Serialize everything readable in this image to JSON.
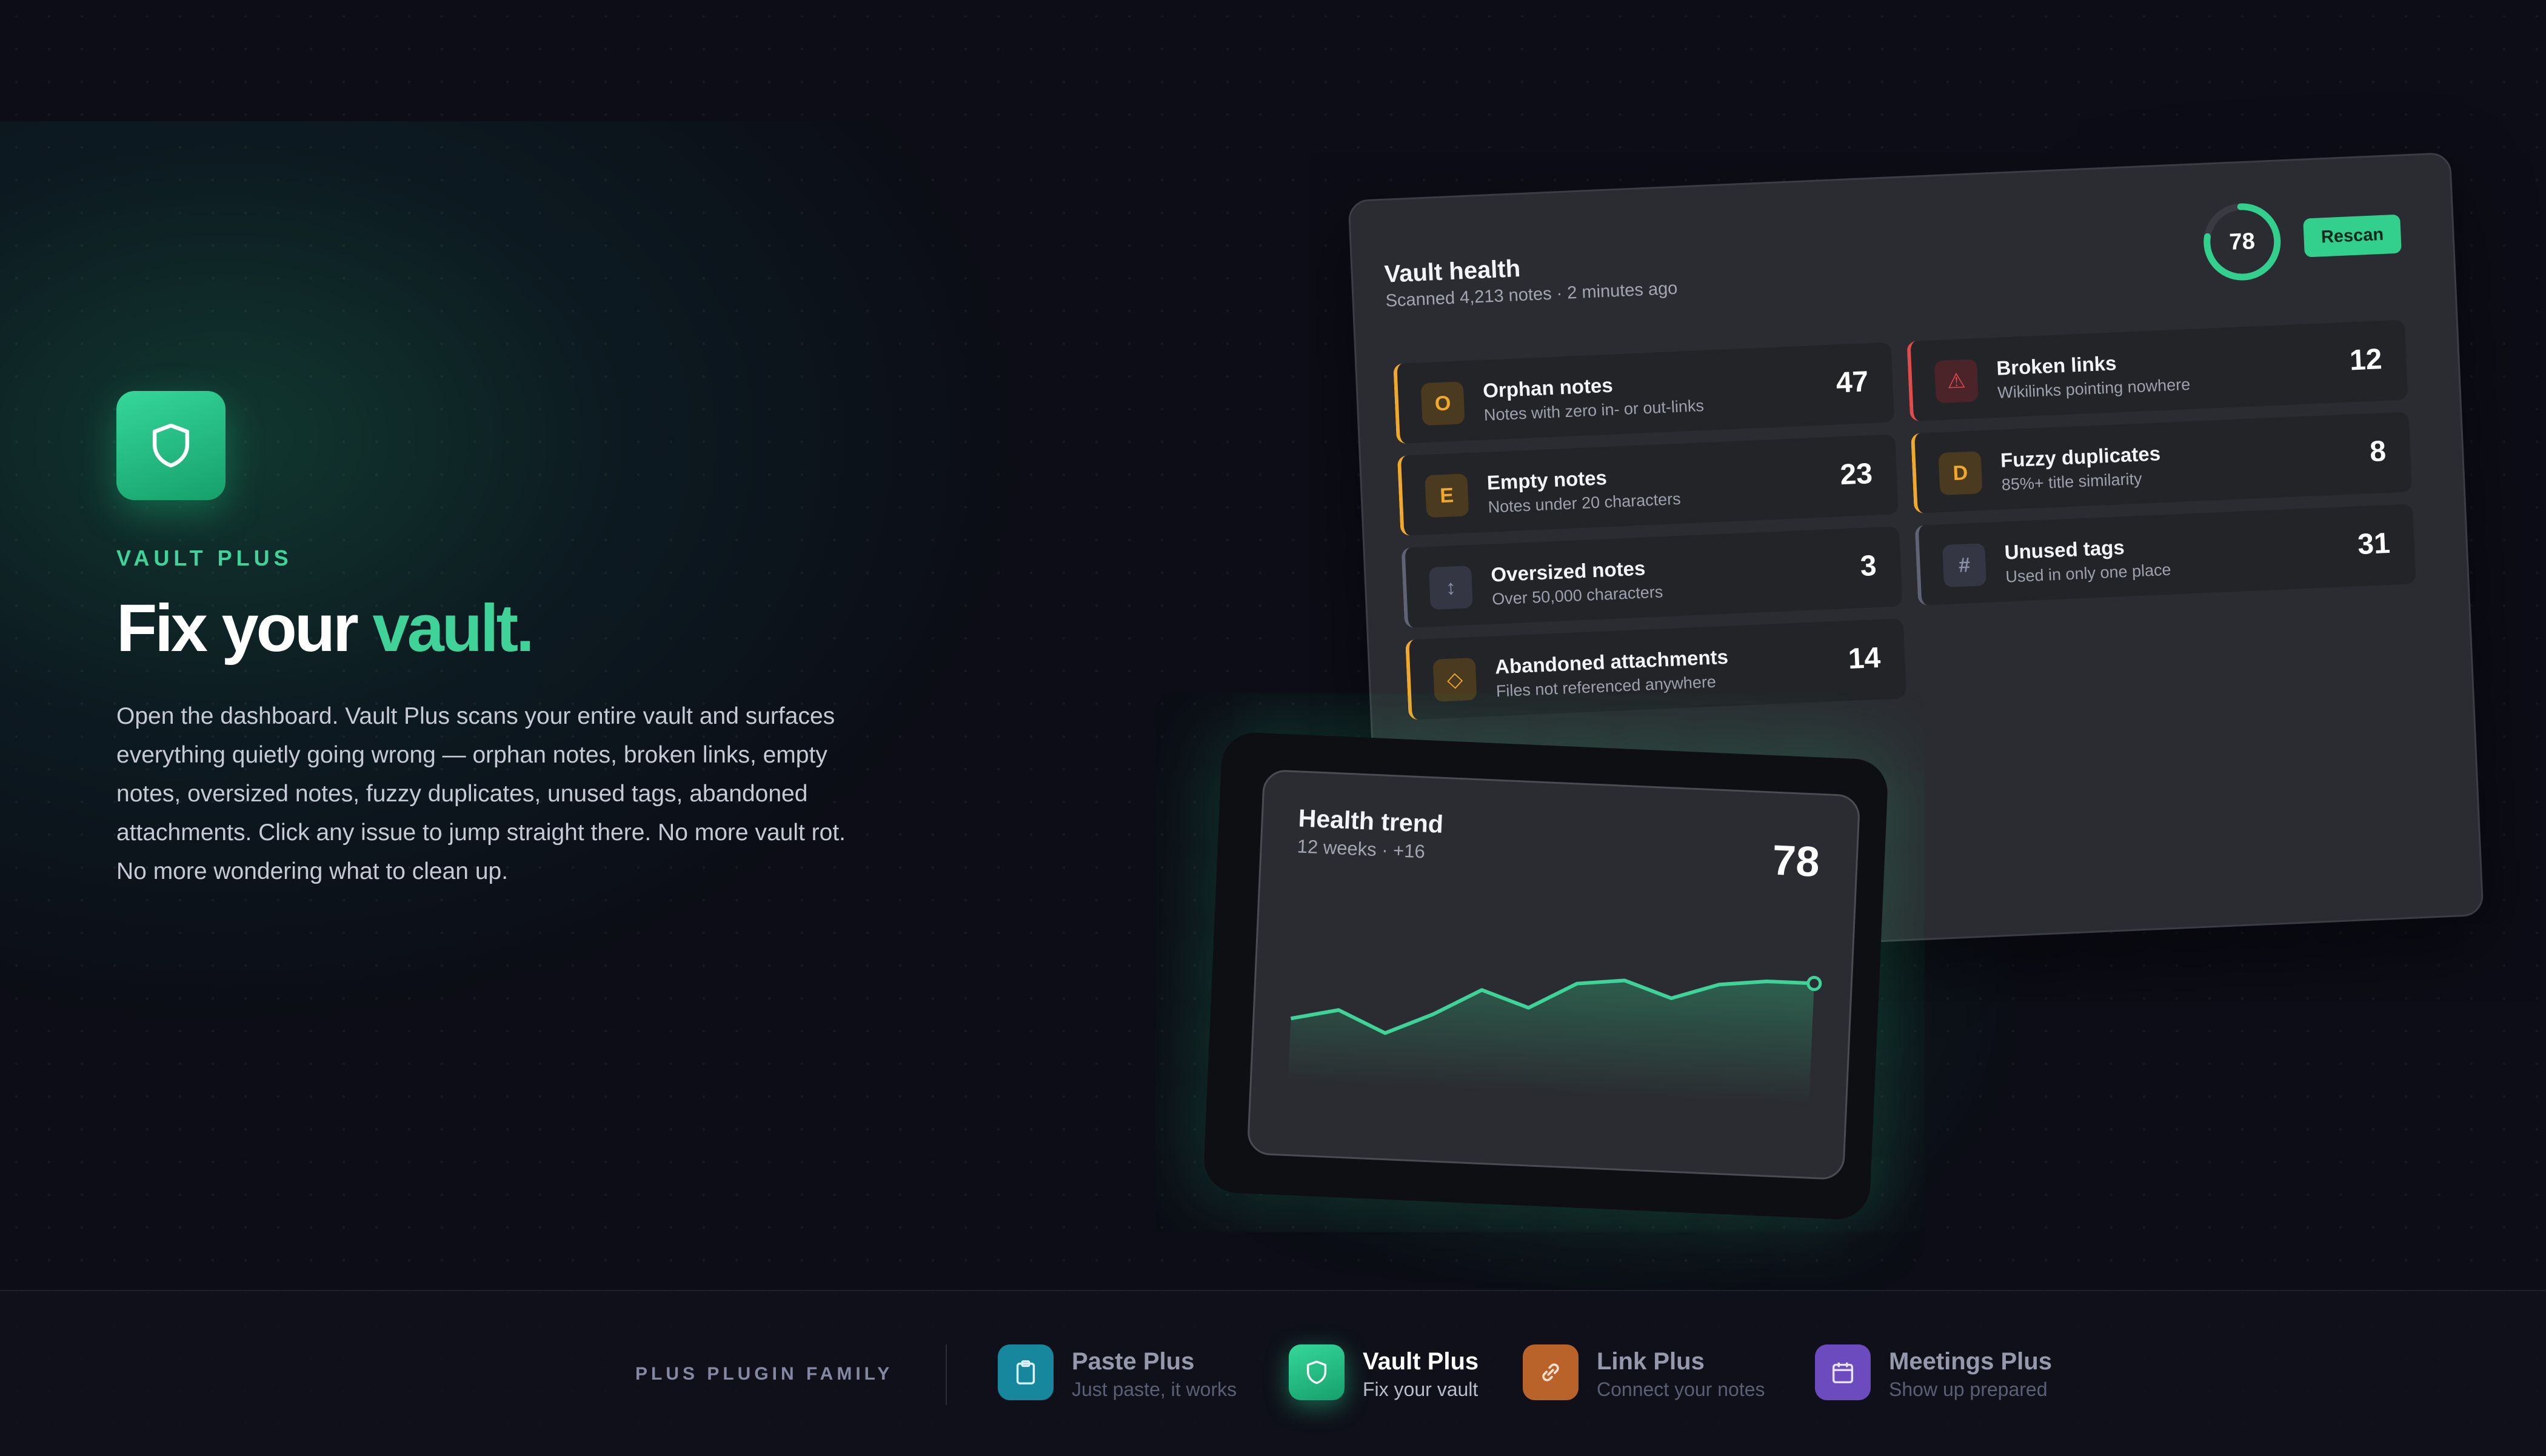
{
  "hero": {
    "eyebrow": "VAULT PLUS",
    "headline_main": "Fix your ",
    "headline_accent": "vault.",
    "description": "Open the dashboard. Vault Plus scans your entire vault and surfaces everything quietly going wrong — orphan notes, broken links, empty notes, oversized notes, fuzzy duplicates, unused tags, abandoned attachments. Click any issue to jump straight there. No more vault rot. No more wondering what to clean up."
  },
  "dashboard": {
    "title": "Vault health",
    "subtitle": "Scanned 4,213 notes · 2 minutes ago",
    "score": "78",
    "score_fraction": 0.78,
    "rescan_label": "Rescan",
    "issues_left": [
      {
        "icon": "O",
        "title": "Orphan notes",
        "desc": "Notes with zero in- or out-links",
        "count": "47",
        "tone": "amber"
      },
      {
        "icon": "E",
        "title": "Empty notes",
        "desc": "Notes under 20 characters",
        "count": "23",
        "tone": "amber"
      },
      {
        "icon": "↕",
        "title": "Oversized notes",
        "desc": "Over 50,000 characters",
        "count": "3",
        "tone": "gray"
      },
      {
        "icon": "◇",
        "title": "Abandoned attachments",
        "desc": "Files not referenced anywhere",
        "count": "14",
        "tone": "amber"
      }
    ],
    "issues_right": [
      {
        "icon": "⚠",
        "title": "Broken links",
        "desc": "Wikilinks pointing nowhere",
        "count": "12",
        "tone": "red"
      },
      {
        "icon": "D",
        "title": "Fuzzy duplicates",
        "desc": "85%+ title similarity",
        "count": "8",
        "tone": "amber"
      },
      {
        "icon": "#",
        "title": "Unused tags",
        "desc": "Used in only one place",
        "count": "31",
        "tone": "gray"
      }
    ]
  },
  "trend": {
    "title": "Health trend",
    "subtitle": "12 weeks · +16",
    "value": "78",
    "points": [
      62,
      64,
      60,
      64,
      69,
      66,
      71,
      72,
      69,
      72,
      73,
      73
    ]
  },
  "footer": {
    "family_label": "PLUS PLUGIN FAMILY",
    "plugins": [
      {
        "name": "Paste Plus",
        "tagline": "Just paste, it works",
        "icon": "clipboard-icon",
        "color": "#1a8fa8",
        "active": false
      },
      {
        "name": "Vault Plus",
        "tagline": "Fix your vault",
        "icon": "shield-icon",
        "color": "#25c083",
        "active": true
      },
      {
        "name": "Link Plus",
        "tagline": "Connect your notes",
        "icon": "link-icon",
        "color": "#c8692a",
        "active": false
      },
      {
        "name": "Meetings Plus",
        "tagline": "Show up prepared",
        "icon": "calendar-icon",
        "color": "#6d4fc0",
        "active": false
      }
    ]
  },
  "colors": {
    "accent": "#3fd39a",
    "warning": "#f0a92a",
    "danger": "#e24b4b",
    "background": "#0c0d16"
  }
}
